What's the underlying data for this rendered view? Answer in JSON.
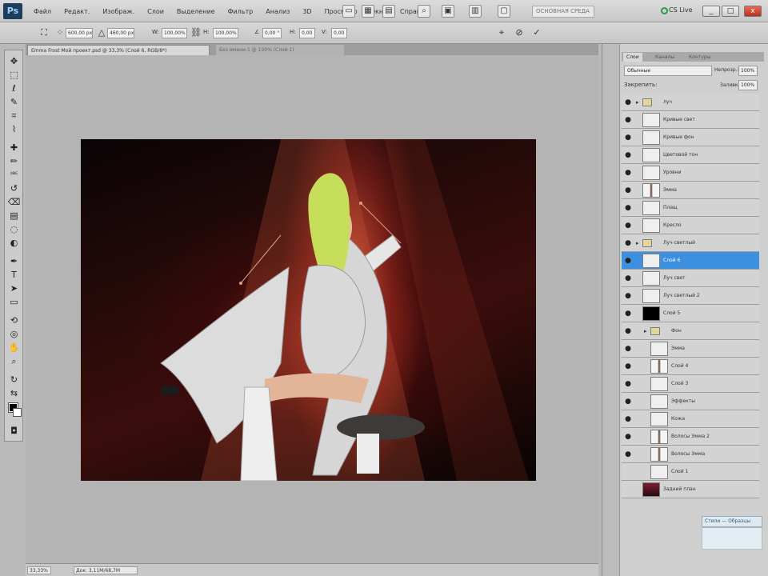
{
  "menubar": {
    "logo": "Ps",
    "items": [
      "Файл",
      "Редакт.",
      "Изображ.",
      "Слои",
      "Выделение",
      "Фильтр",
      "Анализ",
      "3D",
      "Просмотр",
      "Окно",
      "Справка"
    ],
    "workspace": "ОСНОВНАЯ СРЕДА",
    "cs_live": "CS Live",
    "win_min": "_",
    "win_max": "□",
    "win_close": "x"
  },
  "optionsbar": {
    "x_value": "600,00 px",
    "y_value": "460,00 px",
    "w_label": "W:",
    "w_value": "100,00%",
    "h_label": "H:",
    "h_value": "100,00%",
    "angle_label": "∠",
    "angle_value": "0,00 °",
    "hskew_label": "H:",
    "hskew_value": "0,00",
    "vskew_label": "V:",
    "vskew_value": "0,00"
  },
  "doc_tabs": {
    "active": "Emma Frost Мой проект.psd @ 33,3% (Слой 6, RGB/8*)",
    "other": "Без имени-1 @ 100% (Слой 1)"
  },
  "status_bar": {
    "zoom": "33,33%",
    "doc_info": "Док: 3,11M/68,7M"
  },
  "layers_panel": {
    "tabs": [
      "Слои",
      "Каналы",
      "Контуры"
    ],
    "blend_mode": "Обычные",
    "opacity_label": "Непрозр.:",
    "opacity_value": "100%",
    "lock_label": "Закрепить:",
    "fill_label": "Заливка:",
    "fill_value": "100%",
    "layers": [
      {
        "name": "луч",
        "type": "folder",
        "visible": true,
        "indent": 0
      },
      {
        "name": "Кривые свет",
        "type": "plain",
        "visible": true,
        "indent": 0
      },
      {
        "name": "Кривые фон",
        "type": "plain",
        "visible": true,
        "indent": 0
      },
      {
        "name": "Цветовой тон",
        "type": "plain",
        "visible": true,
        "indent": 0
      },
      {
        "name": "Уровни",
        "type": "plain",
        "visible": true,
        "indent": 0
      },
      {
        "name": "Эмма",
        "type": "figure",
        "visible": true,
        "indent": 0
      },
      {
        "name": "Плащ",
        "type": "plain",
        "visible": true,
        "indent": 0
      },
      {
        "name": "Кресло",
        "type": "plain",
        "visible": true,
        "indent": 0
      },
      {
        "name": "Луч светлый",
        "type": "folder",
        "visible": true,
        "indent": 0
      },
      {
        "name": "Слой 6",
        "type": "plain",
        "visible": true,
        "indent": 0,
        "selected": true
      },
      {
        "name": "Луч свет",
        "type": "plain",
        "visible": true,
        "indent": 0
      },
      {
        "name": "Луч светлый 2",
        "type": "plain",
        "visible": true,
        "indent": 0
      },
      {
        "name": "Слой 5",
        "type": "black",
        "visible": true,
        "indent": 0
      },
      {
        "name": "Фон",
        "type": "folder",
        "visible": true,
        "indent": 1
      },
      {
        "name": "Эмма",
        "type": "plain",
        "visible": true,
        "indent": 1
      },
      {
        "name": "Слой 4",
        "type": "figure",
        "visible": true,
        "indent": 1
      },
      {
        "name": "Слой 3",
        "type": "plain",
        "visible": true,
        "indent": 1
      },
      {
        "name": "Эффекты",
        "type": "plain",
        "visible": true,
        "indent": 1
      },
      {
        "name": "Кожа",
        "type": "plain",
        "visible": true,
        "indent": 1
      },
      {
        "name": "Волосы Эмма 2",
        "type": "figure",
        "visible": true,
        "indent": 1
      },
      {
        "name": "Волосы Эмма",
        "type": "figure",
        "visible": true,
        "indent": 1
      },
      {
        "name": "Слой 1",
        "type": "plain",
        "visible": false,
        "indent": 1
      },
      {
        "name": "Задний план",
        "type": "image",
        "visible": false,
        "indent": 0
      }
    ]
  },
  "panel_bottom": {
    "label": "Стили — Образцы"
  },
  "icons": {
    "eye": "eye-icon",
    "move": "move-icon",
    "check": "check-icon",
    "cancel": "cancel-icon",
    "warp": "warp-icon"
  },
  "colors": {
    "selected_layer": "#3d8fe0",
    "foreground": "#000000",
    "background": "#ffffff"
  }
}
